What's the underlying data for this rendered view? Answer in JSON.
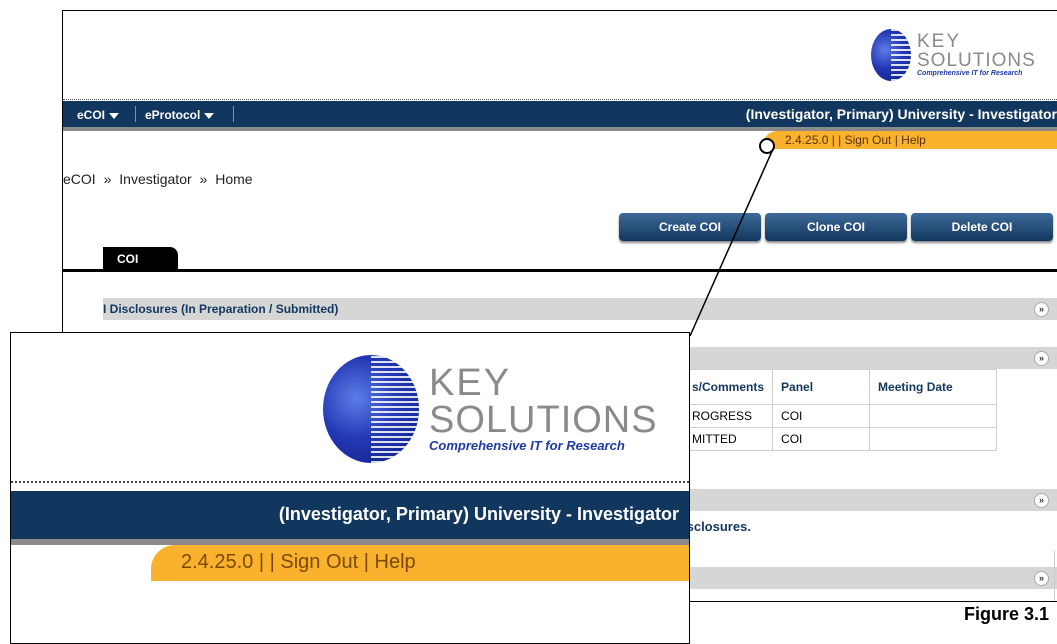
{
  "logo": {
    "word1": "KEY",
    "word2": "SOLUTIONS",
    "tagline": "Comprehensive IT for Research"
  },
  "nav": {
    "menus": [
      {
        "label": "eCOI"
      },
      {
        "label": "eProtocol"
      }
    ],
    "user_role": "(Investigator, Primary) University - Investigator"
  },
  "status": {
    "version": "2.4.25.0",
    "separator": "| |",
    "sign_out": "Sign Out",
    "pipe": "|",
    "help": "Help"
  },
  "breadcrumb": [
    "eCOI",
    "Investigator",
    "Home"
  ],
  "breadcrumb_sep": "»",
  "actions": {
    "create": "Create COI",
    "clone": "Clone COI",
    "delete": "Delete COI"
  },
  "tabs": [
    {
      "label": "COI"
    }
  ],
  "sections": [
    {
      "title": "I Disclosures (In Preparation / Submitted)"
    }
  ],
  "table": {
    "headers": [
      "s/Comments",
      "Panel",
      "Meeting Date"
    ],
    "rows": [
      [
        "ROGRESS",
        "COI",
        ""
      ],
      [
        "MITTED",
        "COI",
        ""
      ]
    ]
  },
  "disclosures_text": "isclosures.",
  "figure_label": "Figure 3.1"
}
